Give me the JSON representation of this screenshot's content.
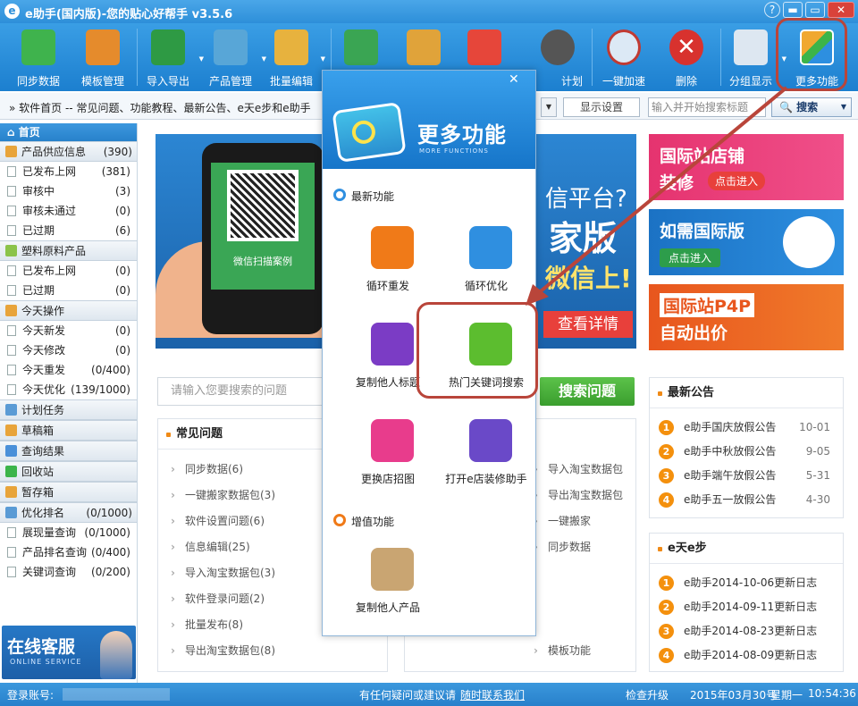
{
  "titlebar": {
    "title": "e助手(国内版)-您的贴心好帮手 v3.5.6",
    "logo": "e",
    "help": "?",
    "min": "▬",
    "max": "▭",
    "close": "✕"
  },
  "toolbar": [
    {
      "label": "同步数据",
      "icon": "download-icon",
      "color": "#3fb34d"
    },
    {
      "label": "模板管理",
      "icon": "template-icon",
      "color": "#e58b2c"
    },
    {
      "label": "导入导出",
      "icon": "excel-icon",
      "color": "#2e9a44"
    },
    {
      "label": "产品管理",
      "icon": "product-icon",
      "color": "#58a6d7"
    },
    {
      "label": "批量编辑",
      "icon": "edit-icon",
      "color": "#e7b23e"
    },
    {
      "label": "",
      "icon": "upload-icon",
      "color": "#3aa553"
    },
    {
      "label": "",
      "icon": "undo-icon",
      "color": "#e0a33a"
    },
    {
      "label": "",
      "icon": "new-chart-icon",
      "color": "#e6463a"
    },
    {
      "label": "计划",
      "icon": "clock-icon",
      "color": "#555"
    },
    {
      "label": "一键加速",
      "icon": "speed-icon",
      "color": "#dce9f5"
    },
    {
      "label": "删除",
      "icon": "delete-icon",
      "color": "#d8322e"
    },
    {
      "label": "分组显示",
      "icon": "group-icon",
      "color": "#dde7f1"
    },
    {
      "label": "更多功能",
      "icon": "more-functions-icon",
      "color": "#f0a830"
    }
  ],
  "navbar": {
    "crumb": "»  软件首页  --   常见问题、功能教程、最新公告、e天e步和e助手",
    "settings": "显示设置",
    "search_placeholder": "输入并开始搜索标题",
    "search_btn": "搜索"
  },
  "sidebar": {
    "home": "首页",
    "groups": [
      {
        "title": "产品供应信息",
        "count": "(390)",
        "items": [
          {
            "label": "已发布上网",
            "count": "(381)"
          },
          {
            "label": "审核中",
            "count": "(3)"
          },
          {
            "label": "审核未通过",
            "count": "(0)"
          },
          {
            "label": "已过期",
            "count": "(6)"
          }
        ]
      },
      {
        "title": "塑料原料产品",
        "count": "",
        "items": [
          {
            "label": "已发布上网",
            "count": "(0)"
          },
          {
            "label": "已过期",
            "count": "(0)"
          }
        ]
      },
      {
        "title": "今天操作",
        "count": "",
        "items": [
          {
            "label": "今天新发",
            "count": "(0)"
          },
          {
            "label": "今天修改",
            "count": "(0)"
          },
          {
            "label": "今天重发",
            "count": "(0/400)"
          },
          {
            "label": "今天优化",
            "count": "(139/1000)"
          }
        ]
      },
      {
        "title": "计划任务",
        "count": "",
        "items": []
      },
      {
        "title": "草稿箱",
        "count": "",
        "items": []
      },
      {
        "title": "查询结果",
        "count": "",
        "items": []
      },
      {
        "title": "回收站",
        "count": "",
        "items": []
      },
      {
        "title": "暂存箱",
        "count": "",
        "items": []
      },
      {
        "title": "优化排名",
        "count": "(0/1000)",
        "items": [
          {
            "label": "展现量查询",
            "count": "(0/1000)"
          },
          {
            "label": "产品排名查询",
            "count": "(0/400)"
          },
          {
            "label": "关键词查询",
            "count": "(0/200)"
          }
        ]
      }
    ],
    "service_big": "在线客服",
    "service_small": "ONLINE SERVICE"
  },
  "banner": {
    "qr_text": "微信扫描案例",
    "t1": "信平台?",
    "t2": "家版",
    "t3": "微信上!",
    "t4": "查看详情"
  },
  "ads": [
    {
      "t1": "国际站店铺",
      "t2": "装修",
      "pill": "点击进入"
    },
    {
      "t1": "如需国际版",
      "pill": "点击进入"
    },
    {
      "t1": "国际站P4P",
      "t2": "自动出价"
    }
  ],
  "question": {
    "placeholder": "请输入您要搜索的问题",
    "button": "搜索问题"
  },
  "faq": {
    "title": "常见问题",
    "left": [
      "同步数据(6)",
      "一键搬家数据包(3)",
      "软件设置问题(6)",
      "信息编辑(25)",
      "导入淘宝数据包(3)",
      "软件登录问题(2)",
      "批量发布(8)",
      "导出淘宝数据包(8)"
    ],
    "right": [
      "导入淘宝数据包",
      "导出淘宝数据包",
      "一键搬家",
      "同步数据",
      "",
      "",
      "",
      "模板功能"
    ]
  },
  "announcements": {
    "title": "最新公告",
    "items": [
      {
        "n": "1",
        "text": "e助手国庆放假公告",
        "date": "10-01"
      },
      {
        "n": "2",
        "text": "e助手中秋放假公告",
        "date": "9-05"
      },
      {
        "n": "3",
        "text": "e助手端午放假公告",
        "date": "5-31"
      },
      {
        "n": "4",
        "text": "e助手五一放假公告",
        "date": "4-30"
      }
    ]
  },
  "daily": {
    "title": "e天e步",
    "items": [
      {
        "n": "1",
        "text": "e助手2014-10-06更新日志"
      },
      {
        "n": "2",
        "text": "e助手2014-09-11更新日志"
      },
      {
        "n": "3",
        "text": "e助手2014-08-23更新日志"
      },
      {
        "n": "4",
        "text": "e助手2014-08-09更新日志"
      }
    ]
  },
  "popup": {
    "title": "更多功能",
    "sub": "MORE FUNCTIONS",
    "close": "✕",
    "sec1": "最新功能",
    "sec2": "增值功能",
    "items": [
      {
        "label": "循环重发",
        "icon": "repost-icon",
        "color": "#f07a18"
      },
      {
        "label": "循环优化",
        "icon": "optimize-icon",
        "color": "#2f8fe0"
      },
      {
        "label": "复制他人标题",
        "icon": "copy-title-icon",
        "color": "#7b3cc5"
      },
      {
        "label": "热门关键词搜索",
        "icon": "keyword-search-icon",
        "color": "#5cbd2f"
      },
      {
        "label": "更换店招图",
        "icon": "image-icon",
        "color": "#e83c8c"
      },
      {
        "label": "打开e店装修助手",
        "icon": "decorate-icon",
        "color": "#6a49c8"
      },
      {
        "label": "复制他人产品",
        "icon": "copy-product-icon",
        "color": "#c9a572"
      }
    ]
  },
  "status": {
    "account": "登录账号:",
    "feedback": "有任何疑问或建议请",
    "contact": "随时联系我们",
    "upgrade": "检查升级",
    "date": "2015年03月30号",
    "week": "星期一",
    "time": "10:54:36"
  }
}
